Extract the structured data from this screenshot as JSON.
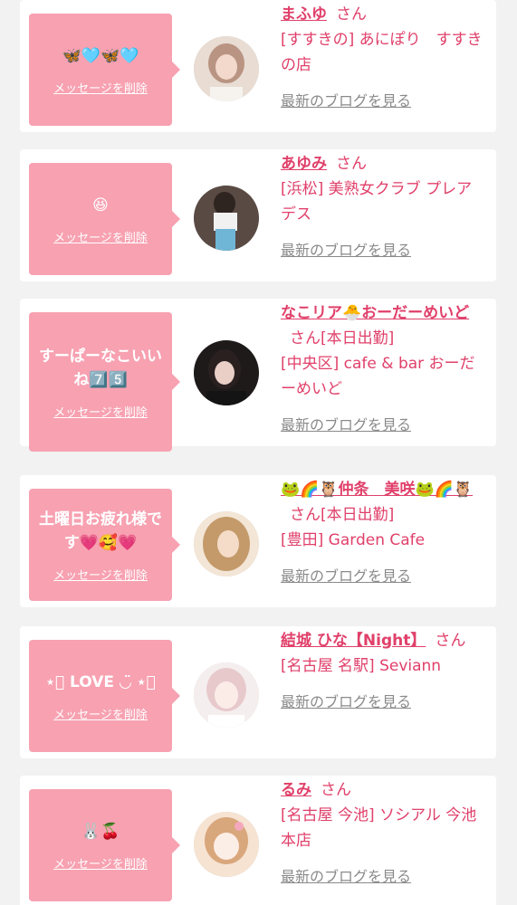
{
  "delete_label": "メッセージを削除",
  "blog_label": "最新のブログを見る",
  "san": "さん",
  "colors": {
    "accent": "#e0406a",
    "bubble": "#f7a1b1",
    "card": "#ffffff",
    "background": "#f2f2f2",
    "link_gray": "#8a8a8a"
  },
  "cards": [
    {
      "message": "🦋🩵🦋🩵",
      "name": "まふゆ",
      "status": "",
      "shop": "[すすきの] あにぽり　すすきの店"
    },
    {
      "message": "😆",
      "name": "あゆみ",
      "status": "",
      "shop": "[浜松] 美熟女クラブ プレアデス"
    },
    {
      "message": "すーぱーなこいいね7️⃣5️⃣",
      "name": "なこリア🐣おーだーめいど",
      "status": "[本日出勤]",
      "shop": "[中央区] cafe & bar おーだーめいど"
    },
    {
      "message": "土曜日お疲れ様です💗🥰💗",
      "name": "🐸🌈🦉仲条　美咲🐸🌈🦉",
      "status": "[本日出勤]",
      "shop": "[豊田] Garden Cafe"
    },
    {
      "message": "⋆͛ LOVE ◡̈ ⋆͛",
      "name": "結城 ひな【Night】",
      "status": "",
      "shop": "[名古屋 名駅] Seviann"
    },
    {
      "message": "🐰🍒",
      "name": "るみ",
      "status": "",
      "shop": "[名古屋 今池] ソシアル 今池本店"
    }
  ]
}
